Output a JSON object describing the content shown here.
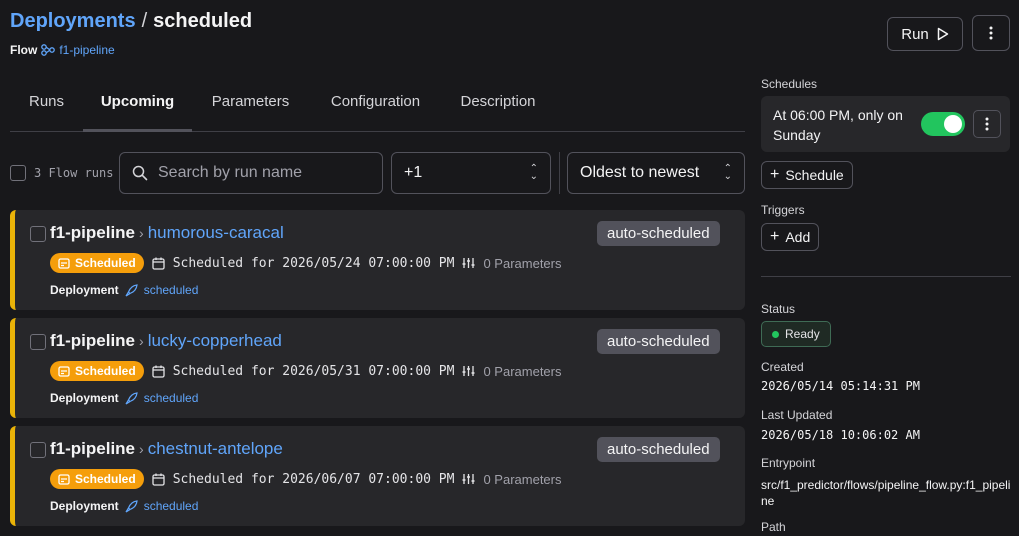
{
  "header": {
    "breadcrumb_root": "Deployments",
    "breadcrumb_sep": "/",
    "breadcrumb_current": "scheduled",
    "flow_label": "Flow",
    "flow_name": "f1-pipeline",
    "run_label": "Run"
  },
  "tabs": [
    "Runs",
    "Upcoming",
    "Parameters",
    "Configuration",
    "Description"
  ],
  "active_tab": "Upcoming",
  "filters": {
    "count_label": "3 Flow runs",
    "search_placeholder": "Search by run name",
    "state_filter": "+1",
    "sort": "Oldest to newest"
  },
  "runs": [
    {
      "flow": "f1-pipeline",
      "name": "humorous-caracal",
      "tag": "auto-scheduled",
      "state": "Scheduled",
      "scheduled_for": "Scheduled for 2026/05/24 07:00:00 PM",
      "params": "0 Parameters",
      "deployment_label": "Deployment",
      "deployment": "scheduled"
    },
    {
      "flow": "f1-pipeline",
      "name": "lucky-copperhead",
      "tag": "auto-scheduled",
      "state": "Scheduled",
      "scheduled_for": "Scheduled for 2026/05/31 07:00:00 PM",
      "params": "0 Parameters",
      "deployment_label": "Deployment",
      "deployment": "scheduled"
    },
    {
      "flow": "f1-pipeline",
      "name": "chestnut-antelope",
      "tag": "auto-scheduled",
      "state": "Scheduled",
      "scheduled_for": "Scheduled for 2026/06/07 07:00:00 PM",
      "params": "0 Parameters",
      "deployment_label": "Deployment",
      "deployment": "scheduled"
    }
  ],
  "sidebar": {
    "schedules_label": "Schedules",
    "schedule_text": "At 06:00 PM, only on Sunday",
    "schedule_enabled": true,
    "add_schedule_label": "Schedule",
    "triggers_label": "Triggers",
    "add_trigger_label": "Add",
    "status_label": "Status",
    "status_value": "Ready",
    "created_label": "Created",
    "created_value": "2026/05/14 05:14:31 PM",
    "updated_label": "Last Updated",
    "updated_value": "2026/05/18 10:06:02 AM",
    "entrypoint_label": "Entrypoint",
    "entrypoint_value": "src/f1_predictor/flows/pipeline_flow.py:f1_pipeline",
    "path_label": "Path"
  },
  "colors": {
    "accent_link": "#60a5fa",
    "scheduled_badge": "#f59e0b",
    "card_stripe": "#eab308",
    "toggle_on": "#22c55e"
  }
}
